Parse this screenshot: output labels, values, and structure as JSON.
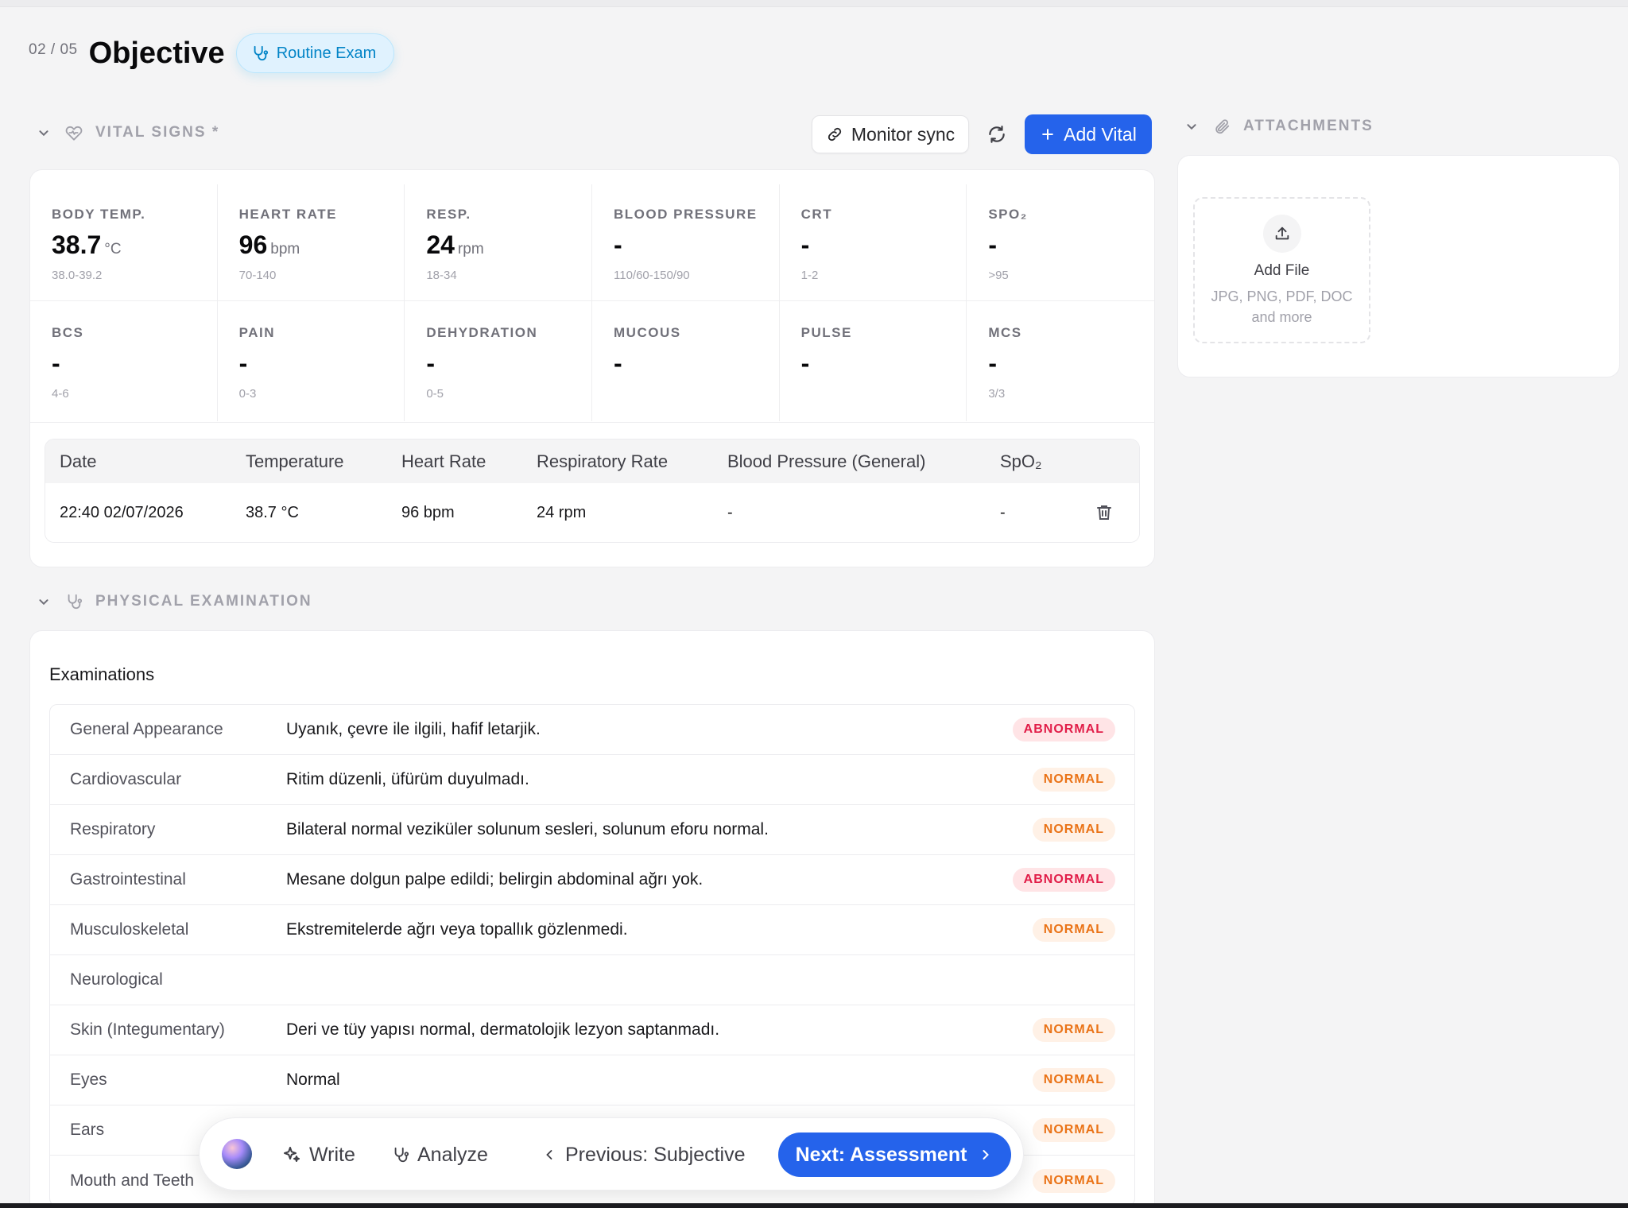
{
  "header": {
    "step": "02 / 05",
    "title": "Objective",
    "exam_type": "Routine Exam"
  },
  "vitals": {
    "section_title": "VITAL SIGNS *",
    "monitor_sync_label": "Monitor sync",
    "add_vital_label": "Add Vital",
    "cells": [
      {
        "label": "BODY TEMP.",
        "value": "38.7",
        "unit": "°C",
        "range": "38.0-39.2"
      },
      {
        "label": "HEART RATE",
        "value": "96",
        "unit": "bpm",
        "range": "70-140"
      },
      {
        "label": "RESP.",
        "value": "24",
        "unit": "rpm",
        "range": "18-34"
      },
      {
        "label": "BLOOD PRESSURE",
        "value": "-",
        "unit": "",
        "range": "110/60-150/90"
      },
      {
        "label": "CRT",
        "value": "-",
        "unit": "",
        "range": "1-2"
      },
      {
        "label": "SPO₂",
        "value": "-",
        "unit": "",
        "range": ">95"
      },
      {
        "label": "BCS",
        "value": "-",
        "unit": "",
        "range": "4-6"
      },
      {
        "label": "PAIN",
        "value": "-",
        "unit": "",
        "range": "0-3"
      },
      {
        "label": "DEHYDRATION",
        "value": "-",
        "unit": "",
        "range": "0-5"
      },
      {
        "label": "MUCOUS",
        "value": "-",
        "unit": "",
        "range": ""
      },
      {
        "label": "PULSE",
        "value": "-",
        "unit": "",
        "range": ""
      },
      {
        "label": "MCS",
        "value": "-",
        "unit": "",
        "range": "3/3"
      }
    ],
    "table": {
      "headers": [
        "Date",
        "Temperature",
        "Heart Rate",
        "Respiratory Rate",
        "Blood Pressure (General)",
        "SpO₂"
      ],
      "rows": [
        [
          "22:40 02/07/2026",
          "38.7 °C",
          "96 bpm",
          "24 rpm",
          "-",
          "-"
        ]
      ]
    }
  },
  "physical_exam": {
    "section_title": "PHYSICAL EXAMINATION",
    "subtitle": "Examinations",
    "rows": [
      {
        "name": "General Appearance",
        "note": "Uyanık, çevre ile ilgili, hafif letarjik.",
        "status": "ABNORMAL"
      },
      {
        "name": "Cardiovascular",
        "note": "Ritim düzenli, üfürüm duyulmadı.",
        "status": "NORMAL"
      },
      {
        "name": "Respiratory",
        "note": "Bilateral normal veziküler solunum sesleri, solunum eforu normal.",
        "status": "NORMAL"
      },
      {
        "name": "Gastrointestinal",
        "note": "Mesane dolgun palpe edildi; belirgin abdominal ağrı yok.",
        "status": "ABNORMAL"
      },
      {
        "name": "Musculoskeletal",
        "note": "Ekstremitelerde ağrı veya topallık gözlenmedi.",
        "status": "NORMAL"
      },
      {
        "name": "Neurological",
        "note": "",
        "status": ""
      },
      {
        "name": "Skin (Integumentary)",
        "note": "Deri ve tüy yapısı normal, dermatolojik lezyon saptanmadı.",
        "status": "NORMAL"
      },
      {
        "name": "Eyes",
        "note": "Normal",
        "status": "NORMAL"
      },
      {
        "name": "Ears",
        "note": "",
        "status": "NORMAL"
      },
      {
        "name": "Mouth and Teeth",
        "note": "",
        "status": "NORMAL"
      }
    ]
  },
  "attachments": {
    "section_title": "ATTACHMENTS",
    "upload_label": "Add File",
    "upload_hint": "JPG, PNG, PDF, DOC and more"
  },
  "dock": {
    "write_label": "Write",
    "analyze_label": "Analyze",
    "prev_label": "Previous: Subjective",
    "next_label": "Next: Assessment"
  },
  "colors": {
    "primary": "#2563eb",
    "normal_tag": "#ea7317",
    "abnormal_tag": "#e11d48",
    "exam_badge": "#0284c7"
  }
}
